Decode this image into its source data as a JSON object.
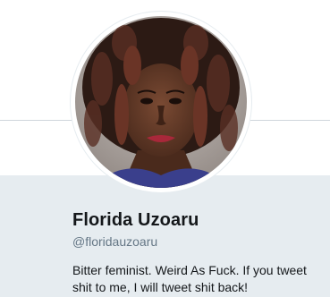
{
  "profile": {
    "name": "Florida Uzoaru",
    "handle": "@floridauzoaru",
    "bio": "Bitter feminist. Weird As Fuck. If you tweet shit to me, I will tweet shit back!"
  },
  "colors": {
    "card_background": "#e6ecf0",
    "name_text": "#14171a",
    "handle_text": "#657786",
    "divider": "#cfd6dc"
  }
}
